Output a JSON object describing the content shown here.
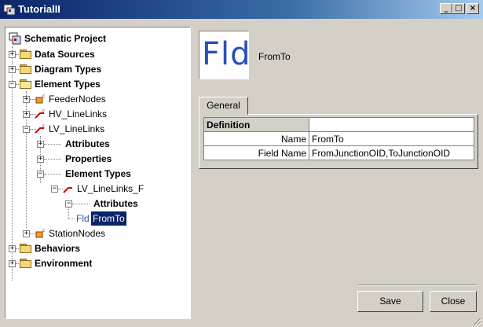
{
  "window": {
    "title": "TutorialII",
    "minimize": "_",
    "maximize": "□",
    "close": "×"
  },
  "tree": {
    "root": "Schematic Project",
    "data_sources": "Data Sources",
    "diagram_types": "Diagram Types",
    "element_types": "Element Types",
    "feeder_nodes": "FeederNodes",
    "hv_linelinks": "HV_LineLinks",
    "lv_linelinks": "LV_LineLinks",
    "attributes": "Attributes",
    "properties": "Properties",
    "element_types_child": "Element Types",
    "lv_linelinks_f": "LV_LineLinks_F",
    "attributes_child": "Attributes",
    "fld_prefix": "Fld",
    "fromto": "FromTo",
    "station_nodes": "StationNodes",
    "behaviors": "Behaviors",
    "environment": "Environment"
  },
  "header": {
    "icon_text": "Fld",
    "name": "FromTo"
  },
  "tabs": {
    "general": "General"
  },
  "table": {
    "header": "Definition",
    "rows": [
      {
        "key": "Name",
        "value": "FromTo"
      },
      {
        "key": "Field Name",
        "value": "FromJunctionOID,ToJunctionOID"
      }
    ]
  },
  "buttons": {
    "save": "Save",
    "close": "Close"
  },
  "colors": {
    "titlebar": "#0a246a",
    "selection": "#0a246a",
    "fld_icon": "#2a4fb5"
  }
}
